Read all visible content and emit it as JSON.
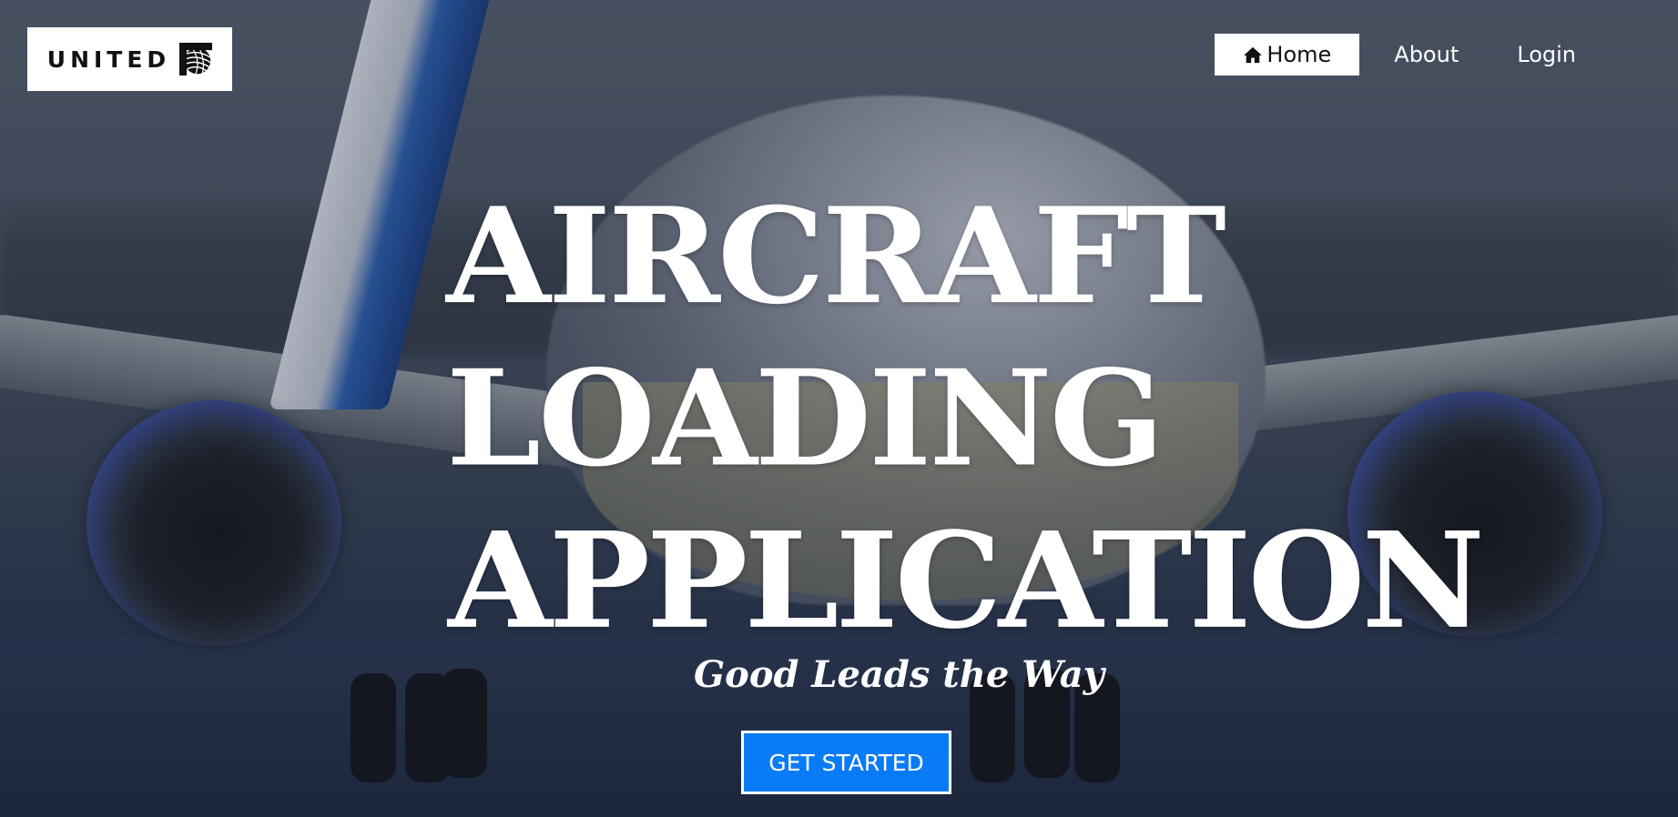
{
  "brand": {
    "logo_text": "UNITED",
    "logo_icon": "globe-icon"
  },
  "nav": {
    "items": [
      {
        "label": "Home",
        "icon": "home-icon",
        "active": true
      },
      {
        "label": "About",
        "active": false
      },
      {
        "label": "Login",
        "active": false
      }
    ]
  },
  "hero": {
    "title_lines": [
      "AIRCRAFT",
      "LOADING",
      "APPLICATION"
    ],
    "tagline": "Good Leads the Way",
    "cta_label": "GET STARTED"
  },
  "colors": {
    "cta_background": "#0a7bf7",
    "nav_active_background": "#ffffff",
    "text": "#ffffff"
  }
}
